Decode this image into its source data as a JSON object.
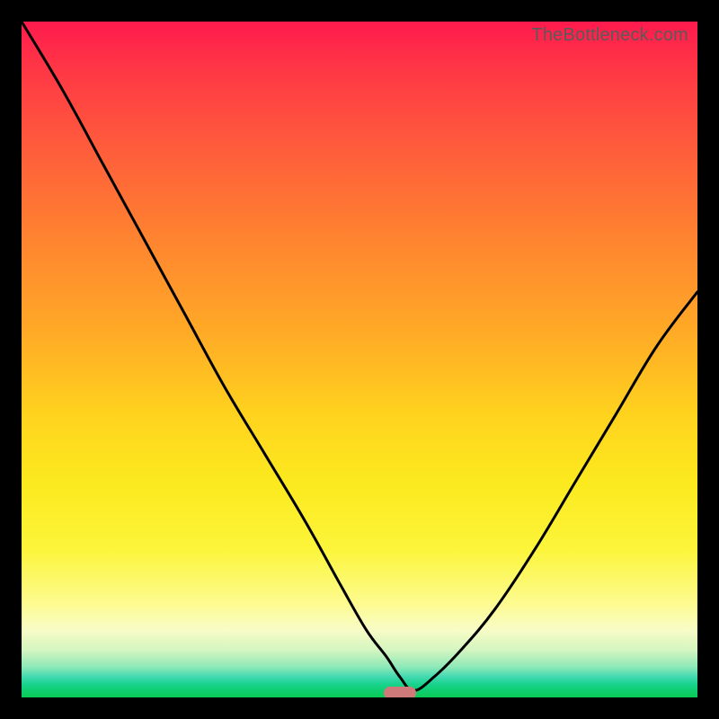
{
  "watermark": "TheBottleneck.com",
  "chart_data": {
    "type": "line",
    "title": "",
    "xlabel": "",
    "ylabel": "",
    "xlim": [
      0,
      100
    ],
    "ylim": [
      0,
      100
    ],
    "grid": false,
    "legend": "none",
    "series": [
      {
        "name": "bottleneck-curve",
        "x": [
          0,
          6,
          12,
          18,
          24,
          30,
          36,
          42,
          47,
          51,
          54,
          56,
          58,
          61,
          65,
          70,
          76,
          82,
          88,
          94,
          100
        ],
        "values": [
          100,
          90,
          79,
          68,
          57,
          46,
          36,
          26,
          17,
          10,
          6,
          3,
          1,
          3,
          7,
          13,
          22,
          32,
          42,
          52,
          60
        ]
      }
    ],
    "marker": {
      "x": 56,
      "y": 0.6,
      "color": "#cf7a7a"
    },
    "gradient_stops": [
      {
        "pos": 0.0,
        "color": "#ff1a4e"
      },
      {
        "pos": 0.18,
        "color": "#ff5a3c"
      },
      {
        "pos": 0.46,
        "color": "#ffaa26"
      },
      {
        "pos": 0.68,
        "color": "#fce91e"
      },
      {
        "pos": 0.9,
        "color": "#f8fcc6"
      },
      {
        "pos": 0.97,
        "color": "#3fd9b0"
      },
      {
        "pos": 1.0,
        "color": "#0acb55"
      }
    ]
  }
}
